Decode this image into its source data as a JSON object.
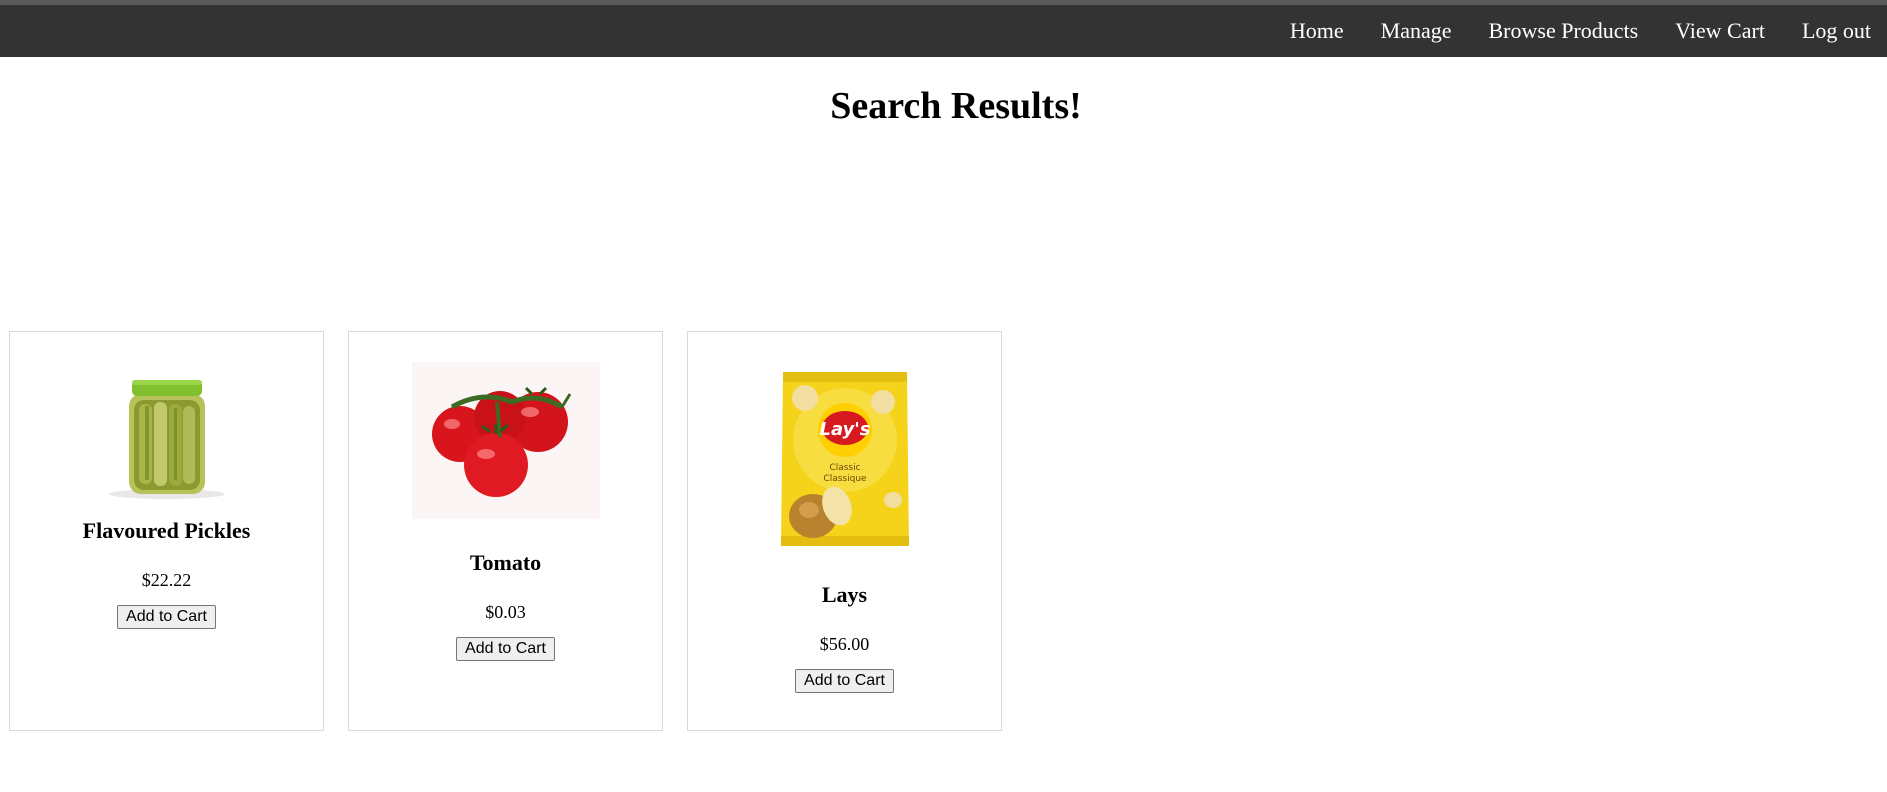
{
  "nav": {
    "items": [
      "Home",
      "Manage",
      "Browse Products",
      "View Cart",
      "Log out"
    ]
  },
  "page": {
    "title": "Search Results!"
  },
  "products": [
    {
      "name": "Flavoured Pickles",
      "price": "$22.22",
      "button": "Add to Cart",
      "image": "pickle-jar-image"
    },
    {
      "name": "Tomato",
      "price": "$0.03",
      "button": "Add to Cart",
      "image": "tomato-image"
    },
    {
      "name": "Lays",
      "price": "$56.00",
      "button": "Add to Cart",
      "image": "lays-chips-bag-image",
      "image_text": [
        "Lay's",
        "Classic",
        "Classique"
      ]
    }
  ],
  "colors": {
    "navbar": "#333333",
    "nav_text": "#ffffff",
    "card_border": "#d9d9d9"
  }
}
